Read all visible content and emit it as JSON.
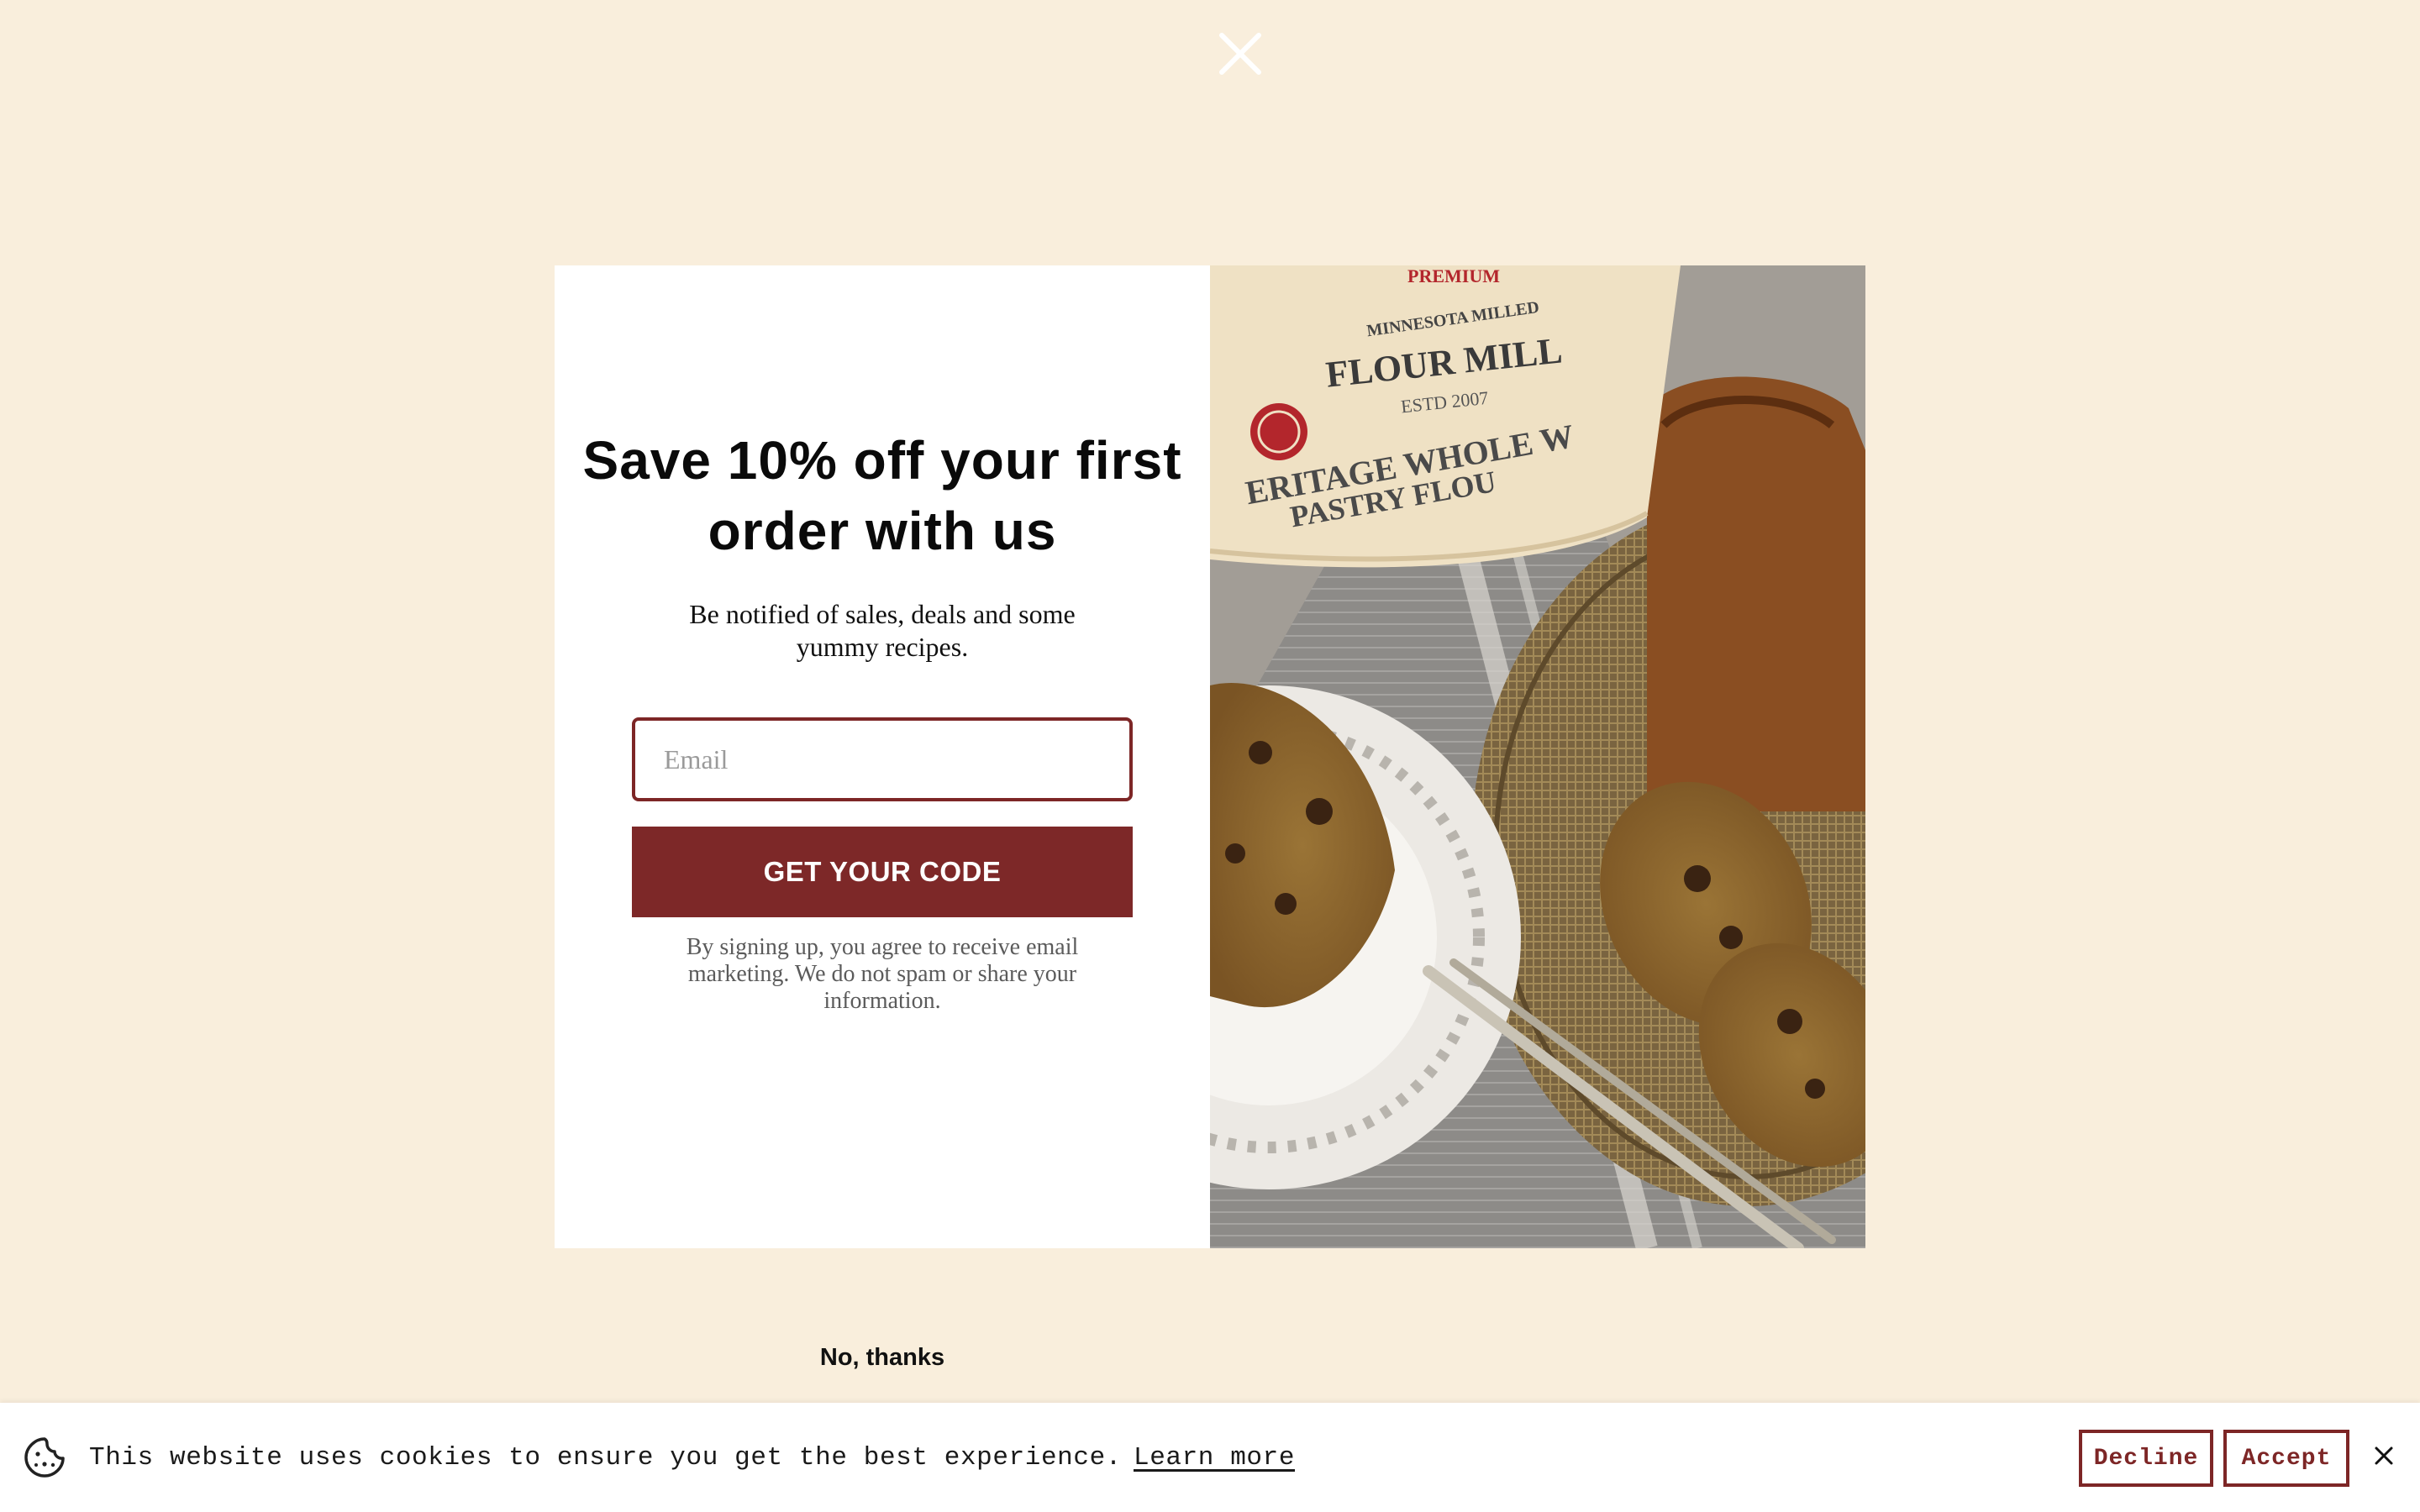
{
  "popup": {
    "headline": "Save 10% off your first order with us",
    "subhead": "Be notified of sales, deals and some yummy recipes.",
    "email_placeholder": "Email",
    "cta_label": "GET YOUR CODE",
    "disclaimer": "By signing up, you agree to receive email marketing. We do not spam or share your information.",
    "no_thanks_label": "No, thanks",
    "close_icon": "close-icon",
    "photo": {
      "bag_premium": "PREMIUM",
      "bag_milled": "MINNESOTA MILLED",
      "bag_brand": "FLOUR MILL",
      "bag_est": "ESTD 2007",
      "bag_product_line1": "ERITAGE WHOLE W",
      "bag_product_line2": "PASTRY FLOU"
    }
  },
  "cookie_banner": {
    "icon": "cookie-icon",
    "message": "This website uses cookies to ensure you get the best experience.",
    "learn_more_label": "Learn more",
    "decline_label": "Decline",
    "accept_label": "Accept",
    "close_icon": "close-icon"
  },
  "colors": {
    "page_background": "#f9eedc",
    "accent": "#7d2828",
    "panel_background": "#ffffff"
  }
}
